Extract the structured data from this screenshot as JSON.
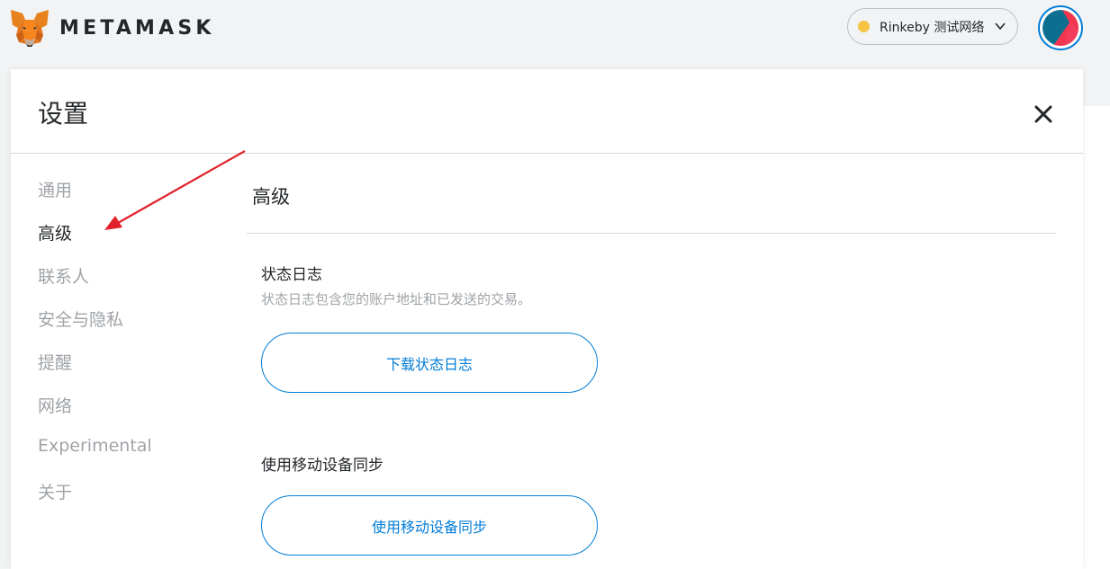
{
  "app": {
    "brand": "METAMASK",
    "network": {
      "label": "Rinkeby 测试网络",
      "dot_color": "#f6c343"
    }
  },
  "settings": {
    "title": "设置",
    "sidebar": {
      "items": [
        {
          "label": "通用"
        },
        {
          "label": "高级",
          "active": true
        },
        {
          "label": "联系人"
        },
        {
          "label": "安全与隐私"
        },
        {
          "label": "提醒"
        },
        {
          "label": "网络"
        },
        {
          "label": "Experimental"
        },
        {
          "label": "关于"
        }
      ]
    },
    "content": {
      "title": "高级",
      "state_logs": {
        "title": "状态日志",
        "description": "状态日志包含您的账户地址和已发送的交易。",
        "button_label": "下载状态日志"
      },
      "mobile_sync": {
        "title": "使用移动设备同步",
        "button_label": "使用移动设备同步"
      }
    }
  },
  "colors": {
    "accent": "#037dd6",
    "annotation": "#e0202a",
    "muted_text": "#9fa3a7"
  },
  "icons": {
    "logo": "metamask-fox-icon",
    "chevron": "chevron-down-icon",
    "close": "close-icon",
    "avatar": "account-identicon"
  }
}
